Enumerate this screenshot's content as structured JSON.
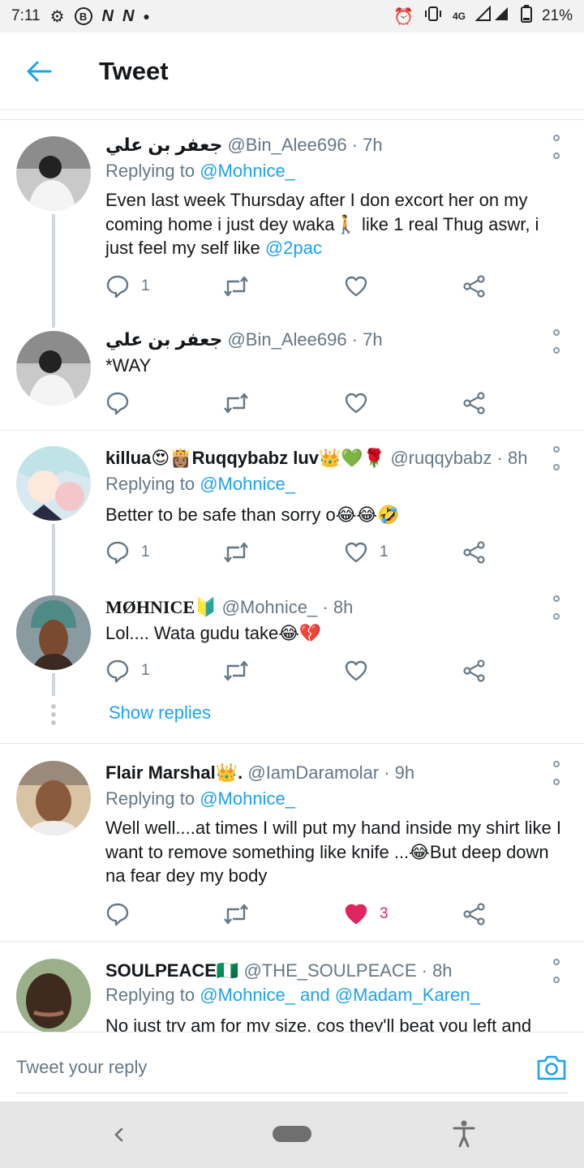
{
  "status_bar": {
    "time": "7:11",
    "left_icons": [
      "gear-icon",
      "b-circle-icon",
      "n-icon",
      "n-icon",
      "dot-icon"
    ],
    "b_label": "B",
    "n_label": "N",
    "network": "4G",
    "battery": "21%"
  },
  "header": {
    "title": "Tweet"
  },
  "tweets": [
    {
      "name": "جعفر بن علي",
      "handle": "@Bin_Alee696",
      "time": "· 7h",
      "replying_prefix": "Replying to ",
      "replying_to": "@Mohnice_",
      "text": "Even last week Thursday after I don excort her on my coming home i just dey waka🚶 like 1 real Thug aswr, i just feel my self like ",
      "text_link": "@2pac",
      "replies": "1",
      "retweets": "",
      "likes": ""
    },
    {
      "name": "جعفر بن علي",
      "handle": "@Bin_Alee696",
      "time": "· 7h",
      "text": "*WAY",
      "replies": "",
      "retweets": "",
      "likes": ""
    },
    {
      "name": "killua😍👸🏽Ruqqybabz luv👑💚🌹",
      "handle": "@ruqqybabz",
      "time": "· 8h",
      "replying_prefix": "Replying to ",
      "replying_to": "@Mohnice_",
      "text": "Better to be safe than sorry o😂😂🤣",
      "replies": "1",
      "retweets": "",
      "likes": "1"
    },
    {
      "name": "MØHNICE🔰",
      "handle": "@Mohnice_",
      "time": "· 8h",
      "text": "Lol.... Wata gudu take😂💔",
      "replies": "1",
      "retweets": "",
      "likes": ""
    },
    {
      "name": "Flair Marshal👑.",
      "handle": "@IamDaramolar",
      "time": "· 9h",
      "replying_prefix": "Replying to ",
      "replying_to": "@Mohnice_",
      "text": "Well well....at times I will put my hand inside my shirt like I want to remove something like knife ...😂But deep down na fear dey my body",
      "replies": "",
      "retweets": "",
      "likes": "3"
    },
    {
      "name": "SOULPEACE🇳🇬",
      "handle": "@THE_SOULPEACE",
      "time": "· 8h",
      "replying_prefix": "Replying to ",
      "replying_to": "@Mohnice_ and @Madam_Karen_",
      "text": "No just try am for my size, cos they'll beat you left and"
    }
  ],
  "show_replies": "Show replies",
  "composer": {
    "placeholder": "Tweet your reply"
  },
  "colors": {
    "link": "#1da1f2",
    "like_active": "#e0245e",
    "meta_text": "#657786"
  }
}
